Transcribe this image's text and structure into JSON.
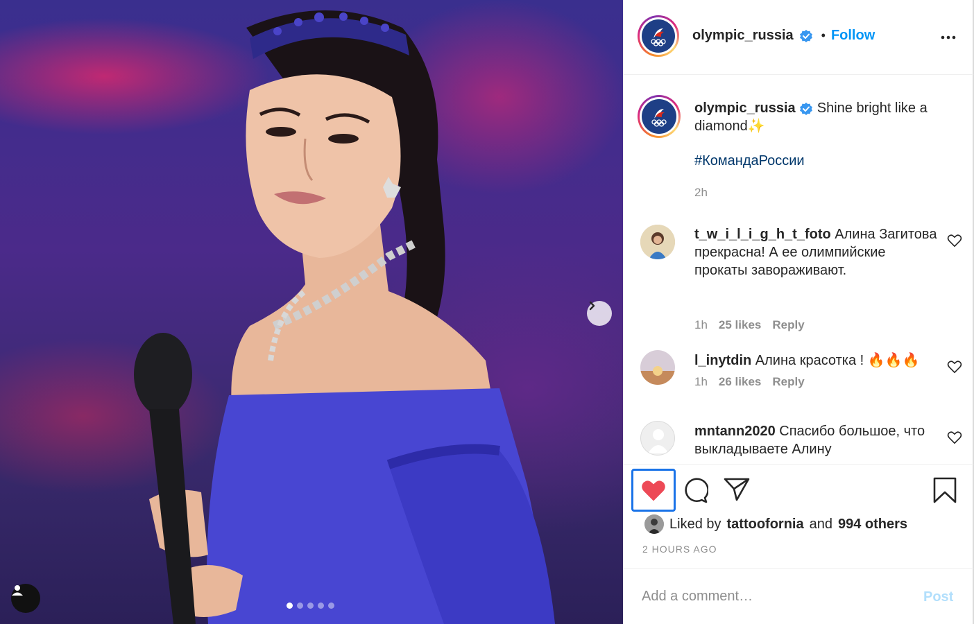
{
  "post": {
    "author": "olympic_russia",
    "follow_label": "Follow",
    "separator": "•",
    "caption": "Shine bright like a diamond✨",
    "hashtag": "#КомандаРоссии",
    "caption_time": "2h",
    "slide_count": 5,
    "active_slide": 1
  },
  "comments": [
    {
      "username": "t_w_i_l_i_g_h_t_foto",
      "text": "Алина Загитова прекрасна! А ее олимпийские прокаты завораживают.",
      "time": "1h",
      "likes": "25 likes",
      "reply": "Reply"
    },
    {
      "username": "l_inytdin",
      "text": "Алина красотка ! 🔥🔥🔥",
      "time": "1h",
      "likes": "26 likes",
      "reply": "Reply"
    },
    {
      "username": "mntann2020",
      "text": "Спасибо большое, что выкладываете Алину",
      "time": "",
      "likes": "",
      "reply": ""
    }
  ],
  "likes_summary": {
    "prefix": "Liked by",
    "user": "tattoofornia",
    "middle": "and",
    "others": "994 others"
  },
  "timestamp": "2 HOURS AGO",
  "comment_box": {
    "placeholder": "Add a comment…",
    "post_label": "Post"
  },
  "colors": {
    "accent": "#0095f6",
    "like_red": "#ed4956",
    "verified": "#3897f0",
    "focus": "#1a73e8"
  },
  "icons": [
    "heart-icon",
    "comment-icon",
    "share-icon",
    "bookmark-icon",
    "more-icon",
    "chevron-right-icon",
    "user-tag-icon",
    "verified-icon"
  ]
}
